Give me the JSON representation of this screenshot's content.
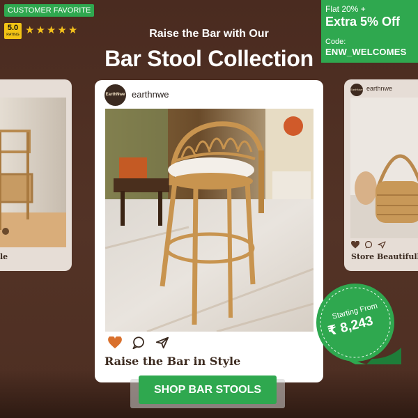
{
  "badges": {
    "customer_favorite": "CUSTOMER FAVORITE",
    "rating_value": "5.0",
    "rating_label": "RATING",
    "stars": [
      "★",
      "★",
      "★",
      "★",
      "★"
    ]
  },
  "offer": {
    "line1": "Flat 20% +",
    "line2": "Extra 5% Off",
    "code_label": "Code:",
    "code": "ENW_WELCOMES"
  },
  "headline": {
    "subtitle": "Raise the Bar with Our",
    "title": "Bar Stool Collection"
  },
  "main_post": {
    "brand_logo": "EarthNwe",
    "handle": "earthnwe",
    "caption": "Raise the Bar in Style",
    "icons": [
      "heart-icon",
      "comment-icon",
      "share-icon"
    ]
  },
  "left_post": {
    "caption": "le"
  },
  "right_post": {
    "brand_logo": "EarthNwe",
    "handle": "earthnwe",
    "caption": "Store Beautifully"
  },
  "price_stamp": {
    "label": "Starting From",
    "price": "₹ 8,243"
  },
  "cta": {
    "label": "SHOP BAR STOOLS"
  },
  "colors": {
    "background": "#4f2f23",
    "accent_green": "#2fa84f",
    "star_yellow": "#f6c21b",
    "heart_orange": "#d9702c"
  }
}
